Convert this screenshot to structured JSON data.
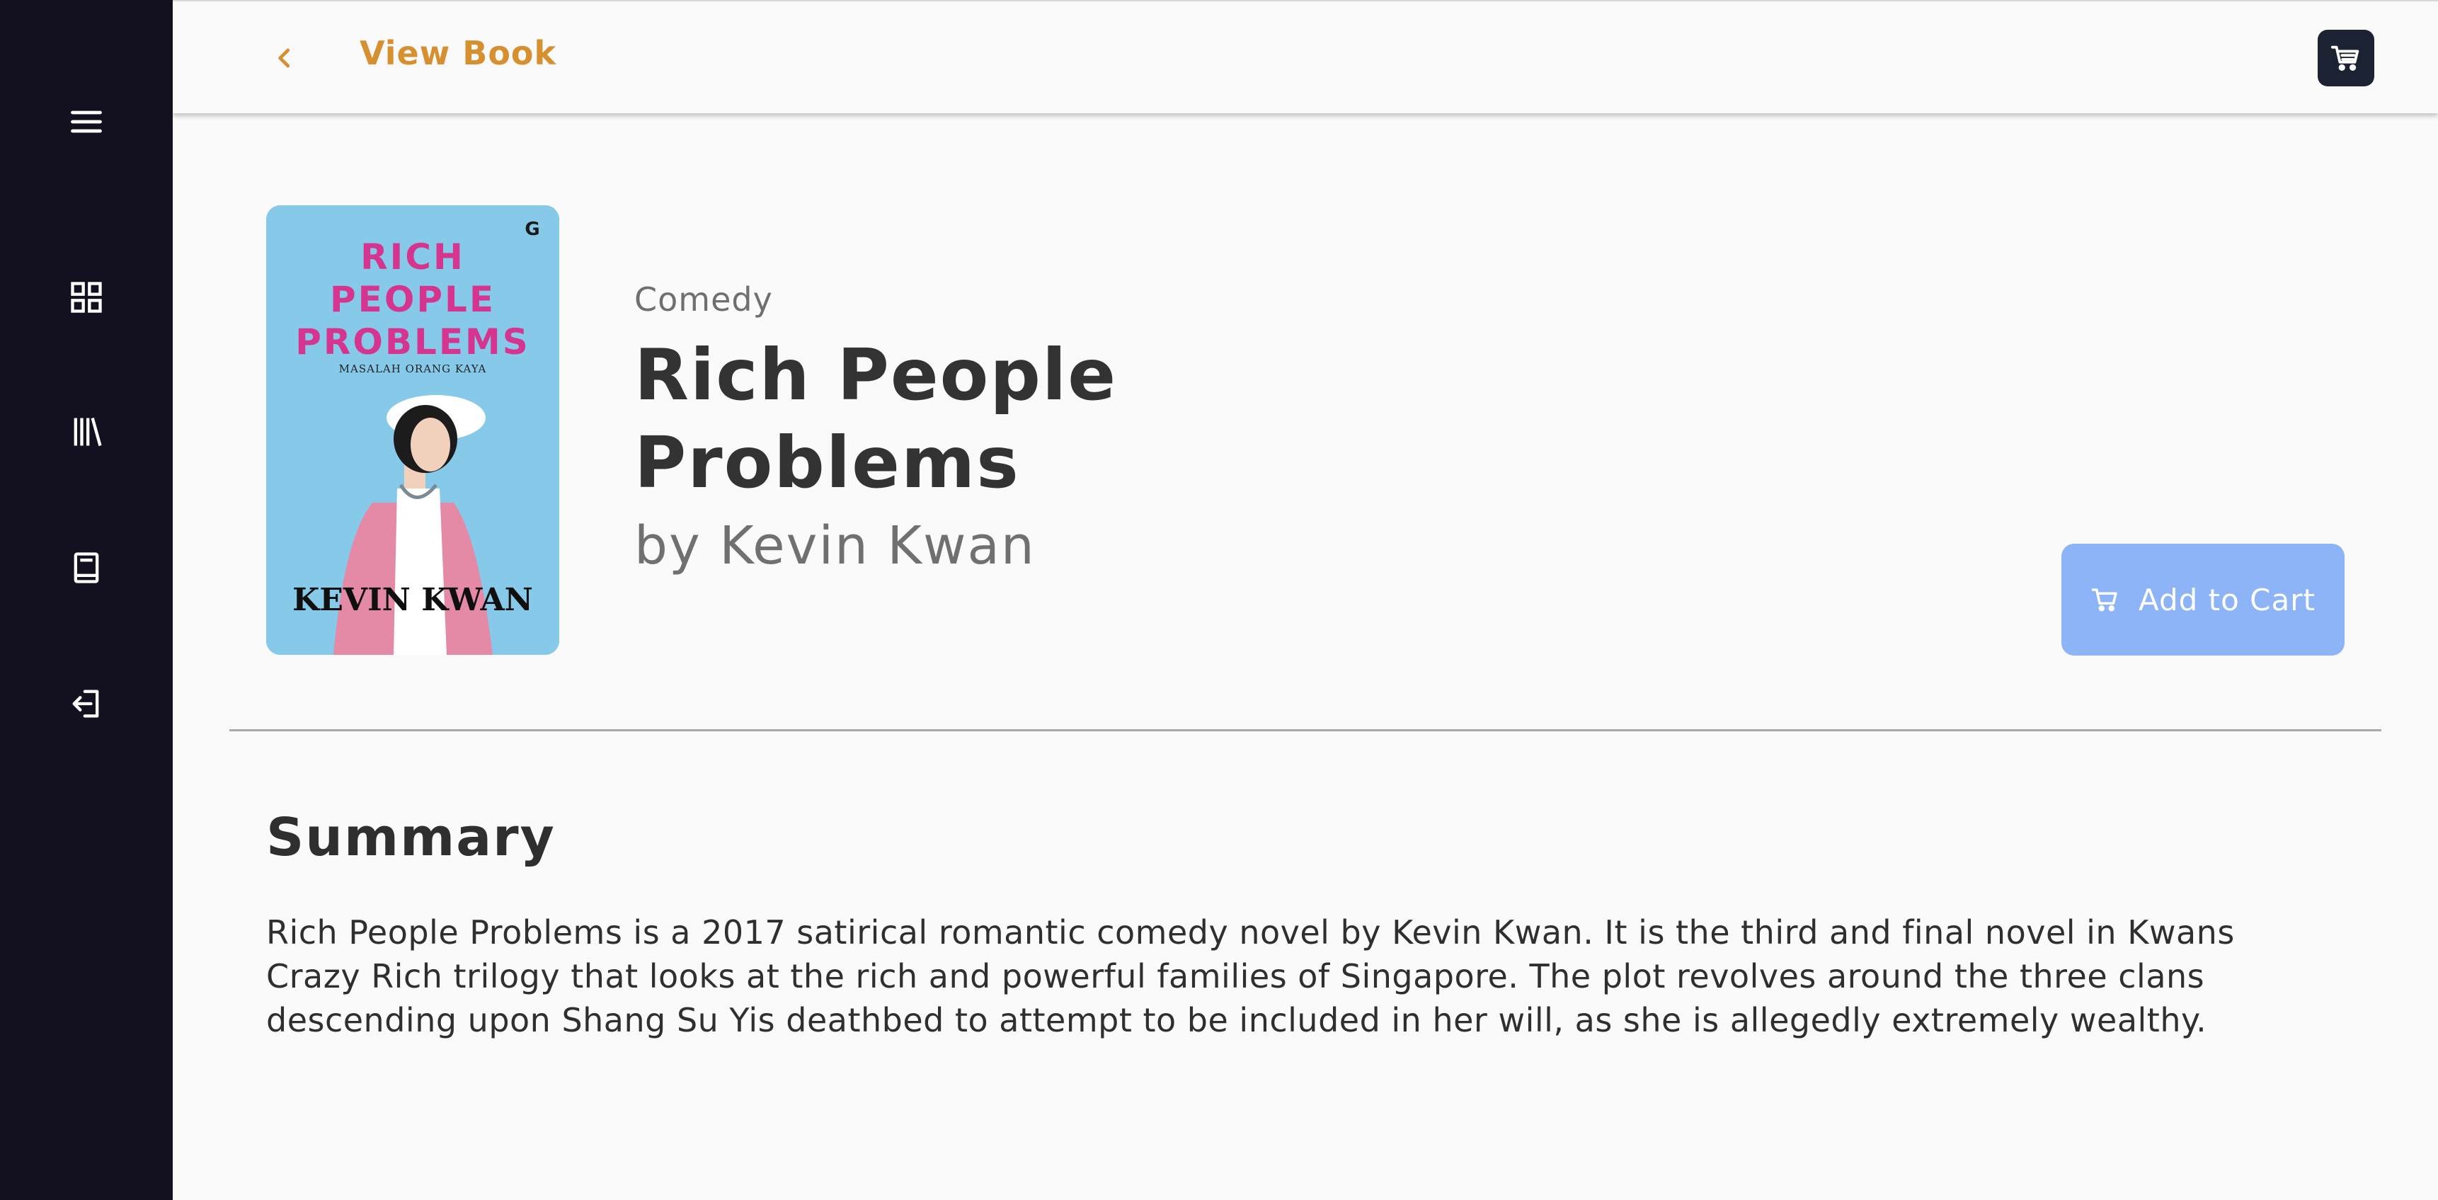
{
  "header": {
    "title": "View Book"
  },
  "sidebar": {
    "items": [
      {
        "icon": "menu-icon"
      },
      {
        "icon": "grid-icon"
      },
      {
        "icon": "library-icon"
      },
      {
        "icon": "book-icon"
      },
      {
        "icon": "logout-icon"
      }
    ]
  },
  "book": {
    "genre": "Comedy",
    "title": "Rich People Problems",
    "author": "by Kevin Kwan",
    "cover": {
      "title_line1": "RICH",
      "title_line2": "PEOPLE",
      "title_line3": "PROBLEMS",
      "subtitle": "MASALAH ORANG KAYA",
      "author": "KEVIN KWAN",
      "publisher": "G"
    }
  },
  "actions": {
    "add_to_cart": "Add to Cart"
  },
  "summary": {
    "heading": "Summary",
    "text": "Rich People Problems is a 2017 satirical romantic comedy novel by Kevin Kwan. It is the third and final novel in Kwans Crazy Rich trilogy that looks at the rich and powerful families of Singapore. The plot revolves around the three clans descending upon Shang Su Yis deathbed to attempt to be included in her will, as she is allegedly extremely wealthy."
  },
  "colors": {
    "sidebar": "#13111f",
    "accent": "#d7902f",
    "cart_button": "#1b2333",
    "add_to_cart": "#8cb4f6",
    "cover_bg": "#86c9e9",
    "cover_title": "#d6358f"
  }
}
